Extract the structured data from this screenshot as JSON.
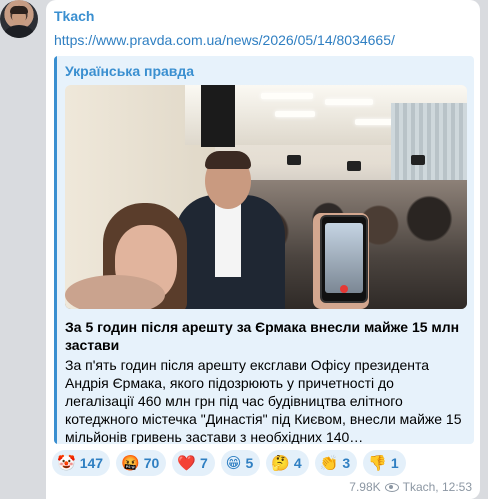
{
  "post": {
    "author": "Tkach",
    "link": "https://www.pravda.com.ua/news/2026/05/14/8034665/",
    "preview": {
      "site_name": "Українська правда",
      "title": "За 5 годин після арешту за Єрмака внесли майже 15 млн застави",
      "description": "За п'ять годин після арешту ексглави Офісу президента Андрія Єрмака, якого підозрюють у причетності до легалізації 460 млн грн під час будівництва елітного котеджного містечка \"Династія\" під Києвом, внесли майже 15 мільйонів гривень застави з необхідних 140…"
    },
    "reactions": [
      {
        "icon": "clown-face-icon",
        "glyph": "🤡",
        "count": "147"
      },
      {
        "icon": "angry-face-icon",
        "glyph": "🤬",
        "count": "70"
      },
      {
        "icon": "heart-icon",
        "glyph": "❤️",
        "count": "7"
      },
      {
        "icon": "grinning-face-icon",
        "glyph": "😁",
        "count": "5"
      },
      {
        "icon": "thinking-face-icon",
        "glyph": "🤔",
        "count": "4"
      },
      {
        "icon": "clapping-hands-icon",
        "glyph": "👏",
        "count": "3"
      },
      {
        "icon": "thumbs-down-icon",
        "glyph": "👎",
        "count": "1"
      }
    ],
    "meta": {
      "views": "7.98K",
      "signature": "Tkach, 12:53"
    }
  },
  "colors": {
    "background": "#d9dbdf",
    "bubble": "#ffffff",
    "accent": "#3a8fd0",
    "preview_bg": "#e7f2fb",
    "reaction_bg": "#e4f0fa"
  }
}
